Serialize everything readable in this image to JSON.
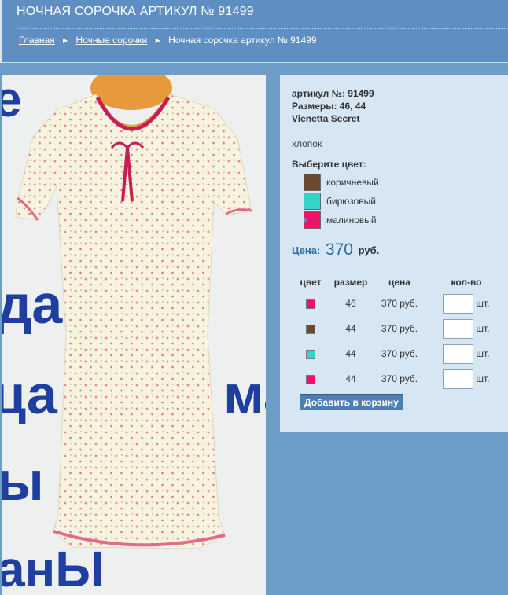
{
  "header": {
    "title": "НОЧНАЯ СОРОЧКА АРТИКУЛ № 91499",
    "breadcrumb": [
      {
        "label": "Главная"
      },
      {
        "label": "Ночные сорочки"
      },
      {
        "label": "Ночная сорочка артикул № 91499"
      }
    ]
  },
  "photo": {
    "background_lettering": [
      "e",
      "да",
      "ца",
      "ма",
      "ы",
      "анЫ"
    ]
  },
  "product": {
    "article": "артикул №: 91499",
    "sizes": "Размеры: 46, 44",
    "brand": "Vienetta  Secret",
    "material": "хлопок",
    "choose_color": "Выберите цвет:",
    "colors": [
      {
        "name": "коричневый",
        "hex": "#6b4a2e"
      },
      {
        "name": "бирюзовый",
        "hex": "#37d3c9"
      },
      {
        "name": "малиновый",
        "hex": "#ee1268"
      }
    ],
    "selected_color_index": 2,
    "price_label": "Цена:",
    "price_value": "370",
    "price_currency": "руб."
  },
  "table": {
    "headers": [
      "цвет",
      "размер",
      "цена",
      "кол-во"
    ],
    "rows": [
      {
        "color_hex": "#ee1268",
        "size": "46",
        "price": "370 руб.",
        "qty": "",
        "unit": "шт."
      },
      {
        "color_hex": "#6b4a2e",
        "size": "44",
        "price": "370 руб.",
        "qty": "",
        "unit": "шт."
      },
      {
        "color_hex": "#37d3c9",
        "size": "44",
        "price": "370 руб.",
        "qty": "",
        "unit": "шт."
      },
      {
        "color_hex": "#ee1268",
        "size": "44",
        "price": "370 руб.",
        "qty": "",
        "unit": "шт."
      }
    ]
  },
  "actions": {
    "add_to_cart": "Добавить в корзину"
  },
  "colors": {
    "page_bg": "#6d9cc9",
    "header_bg": "#5f8fc2",
    "panel_bg": "#d6e6f3",
    "accent": "#2f6aa3"
  }
}
